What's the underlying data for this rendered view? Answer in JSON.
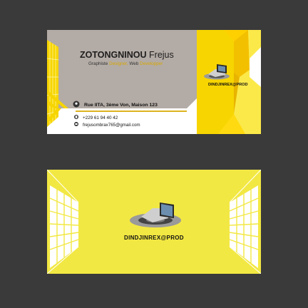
{
  "colors": {
    "background": "#3a3a3a",
    "yellow": "#f7d500",
    "light_yellow": "#f2e843",
    "gray_panel": "#b3aba5",
    "accent_text": "#d8a800"
  },
  "front": {
    "name_last": "ZOTONGNINOU",
    "name_first": "Frejus",
    "role_part1": "Graphiste",
    "role_part2": "Designer,",
    "role_part3": "Web",
    "role_part4": "Developper",
    "brand": "DINDJINREX@PROD",
    "address": "Rue IITA, 3ème Von, Maison 123",
    "phone": "+229 61 94 40 42",
    "email": "frejusombrax765@gmail.com",
    "icons": [
      "location-pin-icon",
      "phone-icon",
      "email-icon"
    ]
  },
  "back": {
    "brand": "DINDJINREX@PROD"
  }
}
